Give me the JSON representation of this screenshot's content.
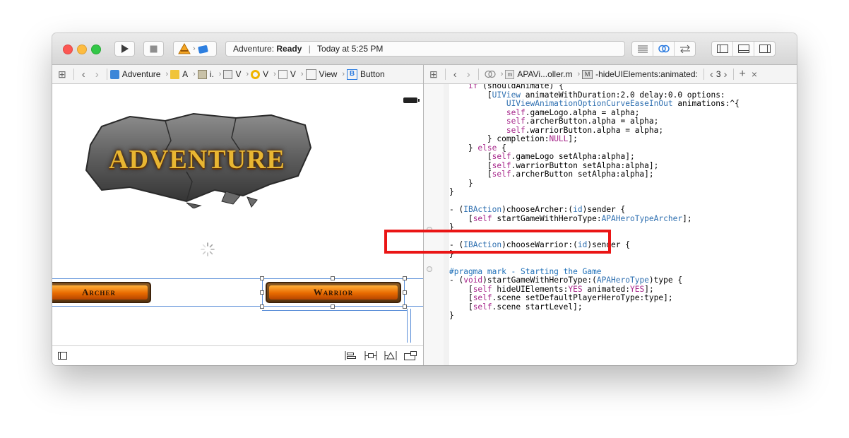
{
  "toolbar": {
    "scheme_icon": "xcode-app-icon",
    "destination_icon": "device-icon",
    "activity_project": "Adventure:",
    "activity_status": "Ready",
    "activity_separator": "|",
    "activity_time": "Today at 5:25 PM"
  },
  "left_jumpbar": {
    "items": [
      "Adventure",
      "A",
      "i.",
      "V",
      "V",
      "V",
      "View",
      "Button"
    ],
    "button_glyph": "B"
  },
  "right_jumpbar": {
    "file": "APAVi...oller.m",
    "method_badge": "M",
    "method": "-hideUIElements:animated:",
    "counter": "3"
  },
  "canvas": {
    "logo_text": "ADVENTURE",
    "archer_label": "Archer",
    "warrior_label": "Warrior"
  },
  "code_lines": [
    "    if (shouldAnimate) {",
    "        [UIView animateWithDuration:2.0 delay:0.0 options:",
    "            UIViewAnimationOptionCurveEaseInOut animations:^{",
    "            self.gameLogo.alpha = alpha;",
    "            self.archerButton.alpha = alpha;",
    "            self.warriorButton.alpha = alpha;",
    "        } completion:NULL];",
    "    } else {",
    "        [self.gameLogo setAlpha:alpha];",
    "        [self.warriorButton setAlpha:alpha];",
    "        [self.archerButton setAlpha:alpha];",
    "    }",
    "}",
    "",
    "- (IBAction)chooseArcher:(id)sender {",
    "    [self startGameWithHeroType:APAHeroTypeArcher];",
    "}",
    "",
    "- (IBAction)chooseWarrior:(id)sender {",
    "}",
    "",
    "#pragma mark - Starting the Game",
    "- (void)startGameWithHeroType:(APAHeroType)type {",
    "    [self hideUIElements:YES animated:YES];",
    "    [self.scene setDefaultPlayerHeroType:type];",
    "    [self.scene startLevel];",
    "}"
  ],
  "colors": {
    "highlight_border": "#ea1515",
    "keyword": "#a6268a",
    "type": "#2e6fb0",
    "selection_guides": "#5b8fd8"
  }
}
